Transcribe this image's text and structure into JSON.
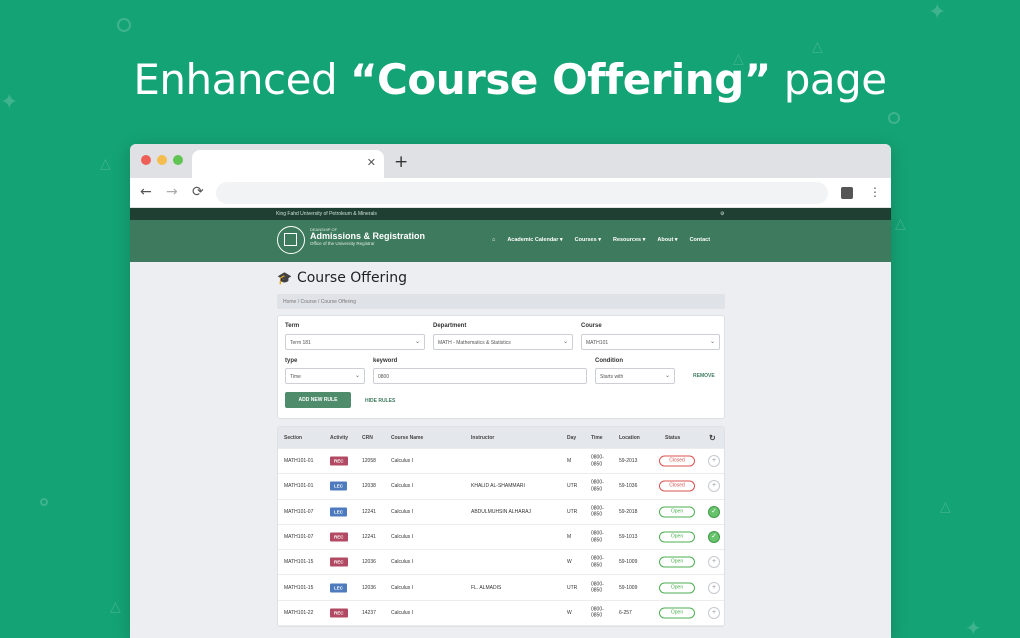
{
  "colors": {
    "background": "#14a374",
    "nav": "#3e7a5e",
    "topbar": "#1e3f31",
    "rec": "#b24a63",
    "lec": "#4e7bbd",
    "closed": "#d9534f",
    "open": "#4caf50"
  },
  "headline": {
    "pre": "Enhanced ",
    "bold": "“Course Offering”",
    "post": " page"
  },
  "browser": {
    "tab_close_icon": "close-icon",
    "newtab_icon": "plus-icon",
    "back_glyph": "←",
    "forward_glyph": "→",
    "reload_glyph": "⟳",
    "menu_glyph": "⋮"
  },
  "site": {
    "university": "King Fahd University of Petroleum & Minerals",
    "language_glyph": "⚙",
    "brand_top": "DEANSHIP OF",
    "brand_main": "Admissions & Registration",
    "brand_sub": "Office of the University Registrar",
    "menu": [
      {
        "label": "⌂"
      },
      {
        "label": "Academic Calendar ▾"
      },
      {
        "label": "Courses ▾"
      },
      {
        "label": "Resources ▾"
      },
      {
        "label": "About ▾"
      },
      {
        "label": "Contact"
      }
    ]
  },
  "page": {
    "title": "Course Offering",
    "breadcrumb": "Home  /  Course  /  Course Offering",
    "filters": {
      "term_label": "Term",
      "term_value": "Term 181",
      "department_label": "Department",
      "department_value": "MATH - Mathematics & Statistics",
      "course_label": "Course",
      "course_value": "MATH101",
      "type_label": "type",
      "type_value": "Time",
      "keyword_label": "keyword",
      "keyword_value": "0800",
      "condition_label": "Condition",
      "condition_value": "Starts with",
      "remove_label": "REMOVE",
      "add_rule_label": "ADD NEW RULE",
      "hide_rules_label": "HIDE RULES"
    },
    "table": {
      "headers": {
        "section": "Section",
        "activity": "Activity",
        "crn": "CRN",
        "course_name": "Course Name",
        "instructor": "Instructor",
        "day": "Day",
        "time": "Time",
        "location": "Location",
        "status": "Status",
        "refresh": "↻"
      },
      "rows": [
        {
          "section": "MATH101-01",
          "activity": "REC",
          "crn": "12058",
          "course_name": "Calculus I",
          "instructor": "",
          "day": "M",
          "time_start": "0800-",
          "time_end": "0850",
          "location": "59-2013",
          "status": "Closed",
          "checked": false
        },
        {
          "section": "MATH101-01",
          "activity": "LEC",
          "crn": "12038",
          "course_name": "Calculus I",
          "instructor": "KHALID AL-SHAMMARI",
          "day": "UTR",
          "time_start": "0800-",
          "time_end": "0850",
          "location": "59-1036",
          "status": "Closed",
          "checked": false
        },
        {
          "section": "MATH101-07",
          "activity": "LEC",
          "crn": "12241",
          "course_name": "Calculus I",
          "instructor": "ABDULMUHSIN ALHARAJ",
          "day": "UTR",
          "time_start": "0800-",
          "time_end": "0850",
          "location": "59-2018",
          "status": "Open",
          "checked": true
        },
        {
          "section": "MATH101-07",
          "activity": "REC",
          "crn": "12241",
          "course_name": "Calculus I",
          "instructor": "",
          "day": "M",
          "time_start": "0800-",
          "time_end": "0850",
          "location": "59-1013",
          "status": "Open",
          "checked": true
        },
        {
          "section": "MATH101-15",
          "activity": "REC",
          "crn": "12036",
          "course_name": "Calculus I",
          "instructor": "",
          "day": "W",
          "time_start": "0800-",
          "time_end": "0850",
          "location": "59-1009",
          "status": "Open",
          "checked": false
        },
        {
          "section": "MATH101-15",
          "activity": "LEC",
          "crn": "12036",
          "course_name": "Calculus I",
          "instructor": "FL. ALMADIS",
          "day": "UTR",
          "time_start": "0800-",
          "time_end": "0850",
          "location": "59-1009",
          "status": "Open",
          "checked": false
        },
        {
          "section": "MATH101-22",
          "activity": "REC",
          "crn": "14237",
          "course_name": "Calculus I",
          "instructor": "",
          "day": "W",
          "time_start": "0800-",
          "time_end": "0850",
          "location": "6-257",
          "status": "Open",
          "checked": false
        }
      ]
    }
  }
}
